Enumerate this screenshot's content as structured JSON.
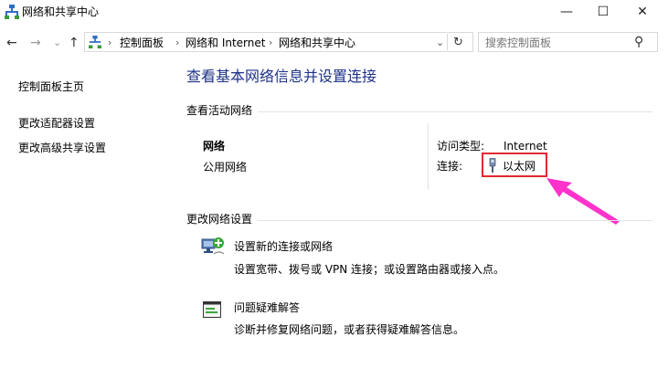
{
  "window": {
    "title": "网络和共享中心",
    "minimize": "—",
    "maximize": "☐",
    "close": "✕"
  },
  "nav": {
    "back": "←",
    "forward": "→",
    "recent": "⌄",
    "up": "↑"
  },
  "address": {
    "crumbs": [
      "控制面板",
      "网络和 Internet",
      "网络和共享中心"
    ],
    "separator": "›",
    "dropdown": "⌄",
    "refresh": "↻"
  },
  "search": {
    "placeholder": "搜索控制面板",
    "icon": "⚲"
  },
  "sidebar": {
    "items": [
      {
        "label": "控制面板主页"
      },
      {
        "label": "更改适配器设置"
      },
      {
        "label": "更改高级共享设置"
      }
    ]
  },
  "main": {
    "heading": "查看基本网络信息并设置连接",
    "active_section": "查看活动网络",
    "network": {
      "name": "网络",
      "profile": "公用网络",
      "access_label": "访问类型:",
      "access_value": "Internet",
      "connection_label": "连接:",
      "connection_value": "以太网"
    },
    "change_section": "更改网络设置",
    "tasks": [
      {
        "title": "设置新的连接或网络",
        "description": "设置宽带、拨号或 VPN 连接；或设置路由器或接入点。"
      },
      {
        "title": "问题疑难解答",
        "description": "诊断并修复网络问题，或者获得疑难解答信息。"
      }
    ]
  },
  "colors": {
    "heading": "#1e3287",
    "link": "#0066cc",
    "highlight_box": "#e0292f",
    "arrow": "#ff33cc"
  }
}
